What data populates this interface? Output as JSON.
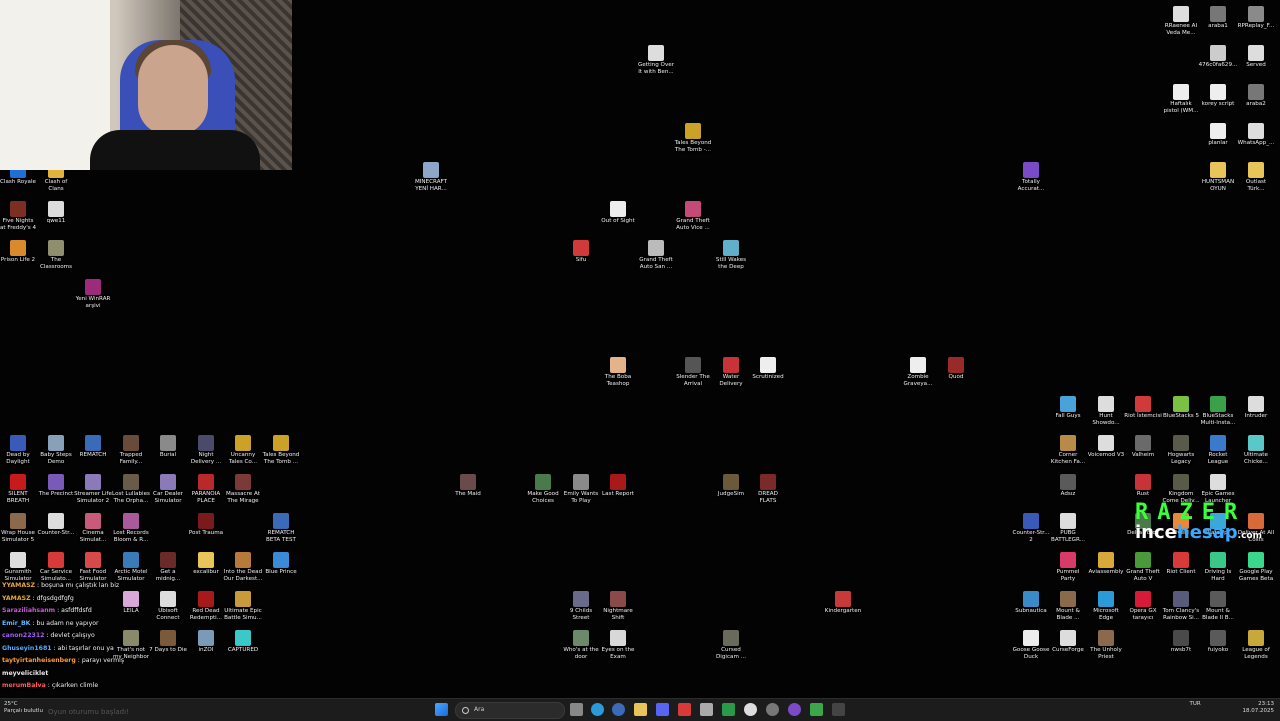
{
  "desktop_icons": [
    {
      "label": "Clash Royale",
      "color": "#1f6fd6"
    },
    {
      "label": "Clash of\nClans",
      "color": "#e3b23c"
    },
    {
      "label": "Five Nights\nat Freddy's 4",
      "color": "#7a2f22"
    },
    {
      "label": "qwe11",
      "color": "#dddddd"
    },
    {
      "label": "Prison Life 2",
      "color": "#d88a2d"
    },
    {
      "label": "The\nClassrooms",
      "color": "#8f8f6f"
    },
    {
      "label": "Yeni WinRAR\narşivi",
      "color": "#9e2a7a"
    },
    {
      "label": "MINECRAFT\nYENİ HAR...",
      "color": "#8da7c8"
    },
    {
      "label": "Getting Over\nIt with Ben...",
      "color": "#dddddd"
    },
    {
      "label": "Tales Beyond\nThe Tomb -...",
      "color": "#c9a227"
    },
    {
      "label": "Out of Sight",
      "color": "#eeeeee"
    },
    {
      "label": "Grand Theft\nAuto Vice ...",
      "color": "#c44a7a"
    },
    {
      "label": "Sifu",
      "color": "#d13a3a"
    },
    {
      "label": "Grand Theft\nAuto San ...",
      "color": "#bbbbbb"
    },
    {
      "label": "Still Wakes\nthe Deep",
      "color": "#5fb0c8"
    },
    {
      "label": "Totally\nAccurat...",
      "color": "#7a4ac8"
    },
    {
      "label": "RRaenee AI\nVeda Me...",
      "color": "#dddddd"
    },
    {
      "label": "araba1",
      "color": "#777777"
    },
    {
      "label": "RPReplay_F...",
      "color": "#8a8a8a"
    },
    {
      "label": "476c0fa629...",
      "color": "#cccccc"
    },
    {
      "label": "Served",
      "color": "#dddddd"
    },
    {
      "label": "Haftalık\npistol (WM...",
      "color": "#eeeeee"
    },
    {
      "label": "korey script",
      "color": "#eeeeee"
    },
    {
      "label": "araba2",
      "color": "#777777"
    },
    {
      "label": "planlar",
      "color": "#eeeeee"
    },
    {
      "label": "WhatsApp_...",
      "color": "#dddddd"
    },
    {
      "label": "HUNTSMAN\nOYUN",
      "color": "#e8c55a"
    },
    {
      "label": "Outlast\nTürk...",
      "color": "#e8c55a"
    },
    {
      "label": "The Boba\nTeashop",
      "color": "#e5b38a"
    },
    {
      "label": "Slender The\nArrival",
      "color": "#555555"
    },
    {
      "label": "Water\nDelivery",
      "color": "#c8333a"
    },
    {
      "label": "Scrutinized",
      "color": "#eeeeee"
    },
    {
      "label": "Zombie\nGraveya...",
      "color": "#eeeeee"
    },
    {
      "label": "Quod",
      "color": "#9a2a2a"
    },
    {
      "label": "Fall Guys",
      "color": "#4aa3d8"
    },
    {
      "label": "Hunt\nShowdo...",
      "color": "#dddddd"
    },
    {
      "label": "Riot İstemcisi",
      "color": "#d13a3a"
    },
    {
      "label": "BlueStacks 5",
      "color": "#7ac143"
    },
    {
      "label": "BlueStacks\nMulti-Insta...",
      "color": "#3aa14a"
    },
    {
      "label": "Intruder",
      "color": "#dddddd"
    },
    {
      "label": "Dead by\nDaylight",
      "color": "#3a5ab8"
    },
    {
      "label": "Baby Steps\nDemo",
      "color": "#8aa0b8"
    },
    {
      "label": "REMATCH",
      "color": "#3a6ab8"
    },
    {
      "label": "Trapped\nFamily...",
      "color": "#6a4a3a"
    },
    {
      "label": "Burial",
      "color": "#8a8a8a"
    },
    {
      "label": "Night\nDelivery ...",
      "color": "#4a4a6a"
    },
    {
      "label": "Uncanny\nTales Co...",
      "color": "#c9a227"
    },
    {
      "label": "Tales Beyond\nThe Tomb ...",
      "color": "#c9a227"
    },
    {
      "label": "Corner\nKitchen Fa...",
      "color": "#b88a4a"
    },
    {
      "label": "Voicemod V3",
      "color": "#dddddd"
    },
    {
      "label": "Valheim",
      "color": "#6a6a6a"
    },
    {
      "label": "Hogwarts\nLegacy",
      "color": "#5a5a4a"
    },
    {
      "label": "Rocket\nLeague",
      "color": "#3a7ac8"
    },
    {
      "label": "Ultimate\nChicke...",
      "color": "#5ac8c8"
    },
    {
      "label": "SILENT\nBREATH",
      "color": "#c81a1a"
    },
    {
      "label": "The Precinct",
      "color": "#7a5ab8"
    },
    {
      "label": "Streamer Life\nSimulator 2",
      "color": "#8a7ab8"
    },
    {
      "label": "Lost Lullabies\nThe Orpha...",
      "color": "#6a5a4a"
    },
    {
      "label": "Car Dealer\nSimulator",
      "color": "#8a7ab8"
    },
    {
      "label": "PARANOIA\nPLACE",
      "color": "#b82a2a"
    },
    {
      "label": "Massacre At\nThe Mirage",
      "color": "#7a3a3a"
    },
    {
      "label": "The Maid",
      "color": "#6a4a4a"
    },
    {
      "label": "Make Good\nChoices",
      "color": "#4a7a4a"
    },
    {
      "label": "Emily Wants\nTo Play",
      "color": "#8a8a8a"
    },
    {
      "label": "Last Report",
      "color": "#a81a1a"
    },
    {
      "label": "JudgeSim",
      "color": "#6a5a3a"
    },
    {
      "label": "DREAD\nFLATS",
      "color": "#7a2a2a"
    },
    {
      "label": "Adsız",
      "color": "#5a5a5a"
    },
    {
      "label": "Rust",
      "color": "#c8333a"
    },
    {
      "label": "Kingdom\nCome Deliv...",
      "color": "#5a5a4a"
    },
    {
      "label": "Epic Games\nLauncher",
      "color": "#dddddd"
    },
    {
      "label": "Wrap House\nSimulator 5",
      "color": "#8a6a4a"
    },
    {
      "label": "Counter-Str...",
      "color": "#dddddd"
    },
    {
      "label": "Cinema\nSimulat...",
      "color": "#c85a7a"
    },
    {
      "label": "Lost Records\nBloom & R...",
      "color": "#a85a9a"
    },
    {
      "label": "Post Trauma",
      "color": "#7a1a1a"
    },
    {
      "label": "REMATCH\nBETA TEST",
      "color": "#3a6ab8"
    },
    {
      "label": "Counter-Str...\n2",
      "color": "#3a5ab8"
    },
    {
      "label": "PUBG\nBATTLEGR...",
      "color": "#dddddd"
    },
    {
      "label": "Delta Force",
      "color": "#4a7a4a"
    },
    {
      "label": "FiveM",
      "color": "#e8883a"
    },
    {
      "label": "PlateUp!",
      "color": "#3aa8d8"
    },
    {
      "label": "Deliver At All\nCosts",
      "color": "#d86a3a"
    },
    {
      "label": "Gunsmith\nSimulator",
      "color": "#dddddd"
    },
    {
      "label": "Car Service\nSimulato...",
      "color": "#d83a3a"
    },
    {
      "label": "Fast Food\nSimulator",
      "color": "#d84a4a"
    },
    {
      "label": "Arctic Motel\nSimulator",
      "color": "#3a7ab8"
    },
    {
      "label": "Get a\nmidnig...",
      "color": "#6a2a2a"
    },
    {
      "label": "excalibur",
      "color": "#e8c55a"
    },
    {
      "label": "Into the Dead\nOur Darkest...",
      "color": "#b87a3a"
    },
    {
      "label": "Blue Prince",
      "color": "#3a8ad8"
    },
    {
      "label": "Pummel\nParty",
      "color": "#d83a6a"
    },
    {
      "label": "Aviassembly",
      "color": "#d8a83a"
    },
    {
      "label": "Grand Theft\nAuto V",
      "color": "#4a9a3a"
    },
    {
      "label": "Riot Client",
      "color": "#d83a3a"
    },
    {
      "label": "Driving Is\nHard",
      "color": "#3ac88a"
    },
    {
      "label": "Google Play\nGames Beta",
      "color": "#3ad88a"
    },
    {
      "label": "LEILA",
      "color": "#d8a8d8"
    },
    {
      "label": "Ubisoft\nConnect",
      "color": "#dddddd"
    },
    {
      "label": "Red Dead\nRedempti...",
      "color": "#a81a1a"
    },
    {
      "label": "Ultimate Epic\nBattle Simu...",
      "color": "#c89a3a"
    },
    {
      "label": "9 Childs\nStreet",
      "color": "#6a6a8a"
    },
    {
      "label": "Nightmare\nShift",
      "color": "#8a4a4a"
    },
    {
      "label": "Kindergarten",
      "color": "#c83a3a"
    },
    {
      "label": "Subnautica",
      "color": "#3a8ac8"
    },
    {
      "label": "Mount &\nBlade ...",
      "color": "#8a6a4a"
    },
    {
      "label": "Microsoft\nEdge",
      "color": "#2a9ad8"
    },
    {
      "label": "Opera GX\ntarayıcı",
      "color": "#d81a3a"
    },
    {
      "label": "Tom Clancy's\nRainbow Si...",
      "color": "#5a5a7a"
    },
    {
      "label": "Mount &\nBlade II B...",
      "color": "#5a5a5a"
    },
    {
      "label": "That's not\nmy Neighbor",
      "color": "#8a8a6a"
    },
    {
      "label": "7 Days to Die",
      "color": "#7a5a3a"
    },
    {
      "label": "inZOI",
      "color": "#7a9ab8"
    },
    {
      "label": "CAPTURED",
      "color": "#3ac8c8"
    },
    {
      "label": "Who's at the\ndoor",
      "color": "#6a8a6a"
    },
    {
      "label": "Eyes on the\nExam",
      "color": "#d8d8d8"
    },
    {
      "label": "Cursed\nDigicam ...",
      "color": "#6a6a5a"
    },
    {
      "label": "Goose Goose\nDuck",
      "color": "#eeeeee"
    },
    {
      "label": "CurseForge",
      "color": "#dddddd"
    },
    {
      "label": "The Unholy\nPriest",
      "color": "#8a6a4a"
    },
    {
      "label": "nwsb7t",
      "color": "#4a4a4a"
    },
    {
      "label": "fuiyoko",
      "color": "#5a5a5a"
    },
    {
      "label": "League of\nLegends",
      "color": "#c8a83a"
    }
  ],
  "chat": [
    {
      "user": "YYAMASZ",
      "text": "boşuna mı çalıştık lan biz",
      "color": "#e8a83a"
    },
    {
      "user": "YAMASZ",
      "text": "dfgsdgdfgfg",
      "color": "#e8a83a"
    },
    {
      "user": "Saraziliahsanm",
      "text": "asfdffdsfd",
      "color": "#c85ad8"
    },
    {
      "user": "Emir_BK",
      "text": "bu adam ne yapıyor",
      "color": "#5ab8ff"
    },
    {
      "user": "canon22312",
      "text": "devlet çalışıyo",
      "color": "#a85aff"
    },
    {
      "user": "Ghuseyin1681",
      "text": "abi taşırlar onu ya",
      "color": "#5aa8ff"
    },
    {
      "user": "taytyirtanheisenberg",
      "text": "parayı vermiş",
      "color": "#ff9a3a"
    },
    {
      "user": "meyveliciklet",
      "text": "",
      "color": "#e8e8e8"
    },
    {
      "user": "merumBalva",
      "text": "çıkarken climle",
      "color": "#ff5a5a"
    }
  ],
  "overlay": {
    "razer_text": "RAZER",
    "site_a": "ince",
    "site_b": "hesap",
    "site_c": ".com"
  },
  "taskbar": {
    "weather_temp": "25°C",
    "weather_desc": "Parçalı bulutlu",
    "search_placeholder": "Ara",
    "language": "TUR",
    "time": "23:13",
    "date": "18.07.2025",
    "faint_caption": "Oyun oturumu başladı!"
  }
}
